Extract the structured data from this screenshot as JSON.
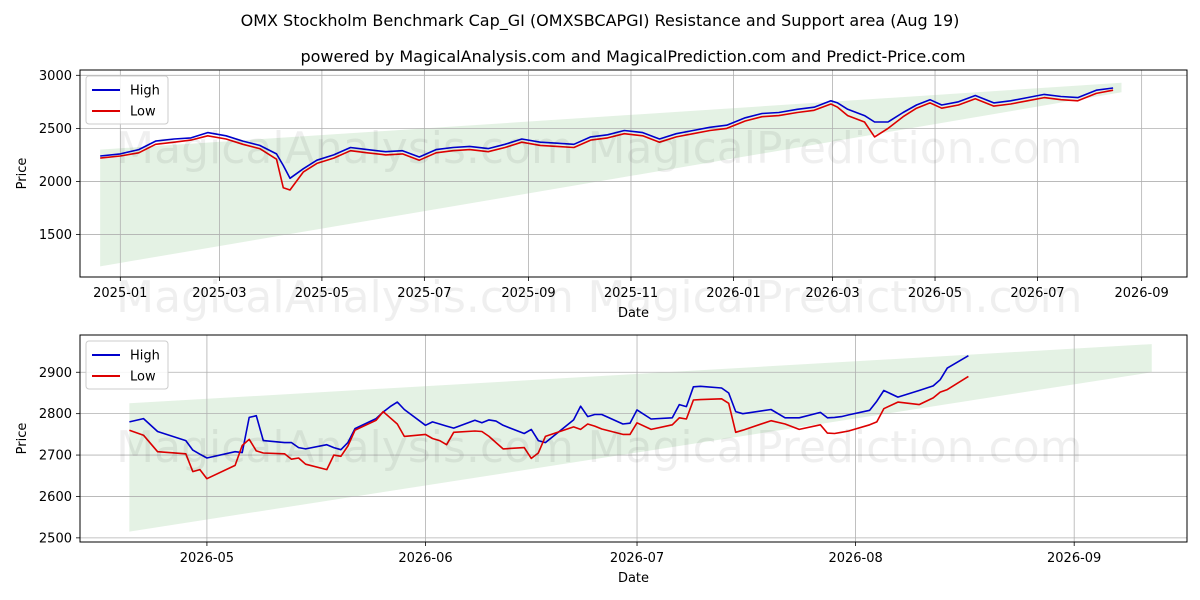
{
  "titles": {
    "main": "OMX Stockholm Benchmark Cap_GI (OMXSBCAPGI) Resistance and Support area (Aug 19)",
    "sub": "powered by MagicalAnalysis.com and MagicalPrediction.com and Predict-Price.com"
  },
  "watermarks": [
    "MagicalAnalysis.com",
    "MagicalPrediction.com"
  ],
  "colors": {
    "high": "#0000cc",
    "low": "#dd0000",
    "band": "#d6ebd6",
    "grid": "#b0b0b0"
  },
  "chart_data": [
    {
      "type": "line",
      "xlabel": "Date",
      "ylabel": "Price",
      "grid": true,
      "legend_placement": "top-left",
      "xlim": [
        "2024-12-08",
        "2026-09-28"
      ],
      "ylim": [
        1100,
        3050
      ],
      "x_ticks": [
        {
          "date": "2025-01-01",
          "label": "2025-01"
        },
        {
          "date": "2025-03-01",
          "label": "2025-03"
        },
        {
          "date": "2025-05-01",
          "label": "2025-05"
        },
        {
          "date": "2025-07-01",
          "label": "2025-07"
        },
        {
          "date": "2025-09-01",
          "label": "2025-09"
        },
        {
          "date": "2025-11-01",
          "label": "2025-11"
        },
        {
          "date": "2026-01-01",
          "label": "2026-01"
        },
        {
          "date": "2026-03-01",
          "label": "2026-03"
        },
        {
          "date": "2026-05-01",
          "label": "2026-05"
        },
        {
          "date": "2026-07-01",
          "label": "2026-07"
        },
        {
          "date": "2026-09-01",
          "label": "2026-09"
        }
      ],
      "y_ticks": [
        1500,
        2000,
        2500,
        3000
      ],
      "band": {
        "x": [
          "2024-12-20",
          "2026-08-20"
        ],
        "lower": [
          1200,
          2840
        ],
        "upper": [
          2300,
          2930
        ]
      },
      "series": [
        {
          "name": "High",
          "x": [
            "2024-12-20",
            "2025-01-01",
            "2025-01-12",
            "2025-01-22",
            "2025-02-02",
            "2025-02-12",
            "2025-02-22",
            "2025-03-05",
            "2025-03-15",
            "2025-03-25",
            "2025-04-04",
            "2025-04-08",
            "2025-04-12",
            "2025-04-20",
            "2025-04-28",
            "2025-05-08",
            "2025-05-18",
            "2025-05-28",
            "2025-06-08",
            "2025-06-18",
            "2025-06-28",
            "2025-07-08",
            "2025-07-18",
            "2025-07-28",
            "2025-08-08",
            "2025-08-18",
            "2025-08-28",
            "2025-09-08",
            "2025-09-18",
            "2025-09-28",
            "2025-10-08",
            "2025-10-18",
            "2025-10-28",
            "2025-11-08",
            "2025-11-18",
            "2025-11-28",
            "2025-12-08",
            "2025-12-18",
            "2025-12-28",
            "2026-01-08",
            "2026-01-18",
            "2026-01-28",
            "2026-02-08",
            "2026-02-18",
            "2026-02-28",
            "2026-03-04",
            "2026-03-10",
            "2026-03-20",
            "2026-03-26",
            "2026-04-03",
            "2026-04-12",
            "2026-04-20",
            "2026-04-28",
            "2026-05-05",
            "2026-05-15",
            "2026-05-25",
            "2026-06-05",
            "2026-06-15",
            "2026-06-25",
            "2026-07-05",
            "2026-07-15",
            "2026-07-25",
            "2026-08-05",
            "2026-08-15"
          ],
          "values": [
            2240,
            2260,
            2300,
            2380,
            2400,
            2410,
            2460,
            2430,
            2380,
            2340,
            2260,
            2150,
            2030,
            2120,
            2200,
            2250,
            2320,
            2300,
            2280,
            2290,
            2230,
            2300,
            2320,
            2330,
            2310,
            2350,
            2400,
            2370,
            2360,
            2350,
            2420,
            2440,
            2480,
            2460,
            2400,
            2450,
            2480,
            2510,
            2530,
            2600,
            2640,
            2650,
            2680,
            2700,
            2760,
            2740,
            2680,
            2620,
            2560,
            2560,
            2650,
            2720,
            2770,
            2720,
            2750,
            2810,
            2740,
            2760,
            2790,
            2820,
            2800,
            2790,
            2860,
            2880
          ]
        },
        {
          "name": "Low",
          "x": [
            "2024-12-20",
            "2025-01-01",
            "2025-01-12",
            "2025-01-22",
            "2025-02-02",
            "2025-02-12",
            "2025-02-22",
            "2025-03-05",
            "2025-03-15",
            "2025-03-25",
            "2025-04-04",
            "2025-04-08",
            "2025-04-12",
            "2025-04-20",
            "2025-04-28",
            "2025-05-08",
            "2025-05-18",
            "2025-05-28",
            "2025-06-08",
            "2025-06-18",
            "2025-06-28",
            "2025-07-08",
            "2025-07-18",
            "2025-07-28",
            "2025-08-08",
            "2025-08-18",
            "2025-08-28",
            "2025-09-08",
            "2025-09-18",
            "2025-09-28",
            "2025-10-08",
            "2025-10-18",
            "2025-10-28",
            "2025-11-08",
            "2025-11-18",
            "2025-11-28",
            "2025-12-08",
            "2025-12-18",
            "2025-12-28",
            "2026-01-08",
            "2026-01-18",
            "2026-01-28",
            "2026-02-08",
            "2026-02-18",
            "2026-02-28",
            "2026-03-04",
            "2026-03-10",
            "2026-03-20",
            "2026-03-26",
            "2026-04-03",
            "2026-04-12",
            "2026-04-20",
            "2026-04-28",
            "2026-05-05",
            "2026-05-15",
            "2026-05-25",
            "2026-06-05",
            "2026-06-15",
            "2026-06-25",
            "2026-07-05",
            "2026-07-15",
            "2026-07-25",
            "2026-08-05",
            "2026-08-15"
          ],
          "values": [
            2220,
            2240,
            2270,
            2350,
            2370,
            2390,
            2430,
            2400,
            2350,
            2310,
            2210,
            1940,
            1920,
            2090,
            2170,
            2220,
            2290,
            2270,
            2250,
            2260,
            2200,
            2270,
            2290,
            2300,
            2280,
            2320,
            2370,
            2340,
            2330,
            2320,
            2390,
            2410,
            2450,
            2430,
            2370,
            2420,
            2450,
            2480,
            2500,
            2570,
            2610,
            2620,
            2650,
            2670,
            2730,
            2700,
            2620,
            2560,
            2420,
            2500,
            2610,
            2690,
            2740,
            2690,
            2720,
            2780,
            2710,
            2730,
            2760,
            2790,
            2770,
            2760,
            2830,
            2860
          ]
        }
      ]
    },
    {
      "type": "line",
      "xlabel": "Date",
      "ylabel": "Price",
      "grid": true,
      "legend_placement": "top-left",
      "xlim": [
        "2026-04-13",
        "2026-09-17"
      ],
      "ylim": [
        2490,
        2990
      ],
      "x_ticks": [
        {
          "date": "2026-05-01",
          "label": "2026-05"
        },
        {
          "date": "2026-06-01",
          "label": "2026-06"
        },
        {
          "date": "2026-07-01",
          "label": "2026-07"
        },
        {
          "date": "2026-08-01",
          "label": "2026-08"
        },
        {
          "date": "2026-09-01",
          "label": "2026-09"
        }
      ],
      "y_ticks": [
        2500,
        2600,
        2700,
        2800,
        2900
      ],
      "band": {
        "x": [
          "2026-04-20",
          "2026-09-12"
        ],
        "lower": [
          2515,
          2900
        ],
        "upper": [
          2825,
          2968
        ]
      },
      "series": [
        {
          "name": "High",
          "x": [
            "2026-04-20",
            "2026-04-22",
            "2026-04-24",
            "2026-04-28",
            "2026-04-29",
            "2026-04-30",
            "2026-05-01",
            "2026-05-05",
            "2026-05-06",
            "2026-05-07",
            "2026-05-08",
            "2026-05-09",
            "2026-05-12",
            "2026-05-13",
            "2026-05-14",
            "2026-05-15",
            "2026-05-18",
            "2026-05-19",
            "2026-05-20",
            "2026-05-21",
            "2026-05-22",
            "2026-05-25",
            "2026-05-26",
            "2026-05-27",
            "2026-05-28",
            "2026-05-29",
            "2026-06-01",
            "2026-06-02",
            "2026-06-03",
            "2026-06-04",
            "2026-06-05",
            "2026-06-08",
            "2026-06-09",
            "2026-06-10",
            "2026-06-11",
            "2026-06-12",
            "2026-06-15",
            "2026-06-16",
            "2026-06-17",
            "2026-06-18",
            "2026-06-22",
            "2026-06-23",
            "2026-06-24",
            "2026-06-25",
            "2026-06-26",
            "2026-06-29",
            "2026-06-30",
            "2026-07-01",
            "2026-07-03",
            "2026-07-06",
            "2026-07-07",
            "2026-07-08",
            "2026-07-09",
            "2026-07-10",
            "2026-07-13",
            "2026-07-14",
            "2026-07-15",
            "2026-07-16",
            "2026-07-20",
            "2026-07-22",
            "2026-07-24",
            "2026-07-27",
            "2026-07-28",
            "2026-07-29",
            "2026-07-30",
            "2026-07-31",
            "2026-08-03",
            "2026-08-04",
            "2026-08-05",
            "2026-08-07",
            "2026-08-10",
            "2026-08-12",
            "2026-08-13",
            "2026-08-14",
            "2026-08-17"
          ],
          "values": [
            2780,
            2788,
            2757,
            2735,
            2712,
            2702,
            2693,
            2708,
            2706,
            2791,
            2795,
            2735,
            2730,
            2730,
            2718,
            2715,
            2725,
            2718,
            2713,
            2730,
            2764,
            2788,
            2804,
            2817,
            2828,
            2810,
            2772,
            2780,
            2775,
            2770,
            2765,
            2784,
            2778,
            2785,
            2782,
            2772,
            2752,
            2762,
            2735,
            2730,
            2785,
            2818,
            2793,
            2798,
            2798,
            2775,
            2777,
            2809,
            2787,
            2790,
            2822,
            2817,
            2865,
            2866,
            2862,
            2850,
            2805,
            2800,
            2810,
            2790,
            2790,
            2803,
            2790,
            2791,
            2793,
            2797,
            2808,
            2830,
            2856,
            2840,
            2856,
            2867,
            2882,
            2910,
            2940
          ]
        },
        {
          "name": "Low",
          "x": [
            "2026-04-20",
            "2026-04-22",
            "2026-04-24",
            "2026-04-28",
            "2026-04-29",
            "2026-04-30",
            "2026-05-01",
            "2026-05-05",
            "2026-05-06",
            "2026-05-07",
            "2026-05-08",
            "2026-05-09",
            "2026-05-12",
            "2026-05-13",
            "2026-05-14",
            "2026-05-15",
            "2026-05-18",
            "2026-05-19",
            "2026-05-20",
            "2026-05-21",
            "2026-05-22",
            "2026-05-25",
            "2026-05-26",
            "2026-05-27",
            "2026-05-28",
            "2026-05-29",
            "2026-06-01",
            "2026-06-02",
            "2026-06-03",
            "2026-06-04",
            "2026-06-05",
            "2026-06-08",
            "2026-06-09",
            "2026-06-10",
            "2026-06-11",
            "2026-06-12",
            "2026-06-15",
            "2026-06-16",
            "2026-06-17",
            "2026-06-18",
            "2026-06-22",
            "2026-06-23",
            "2026-06-24",
            "2026-06-25",
            "2026-06-26",
            "2026-06-29",
            "2026-06-30",
            "2026-07-01",
            "2026-07-03",
            "2026-07-06",
            "2026-07-07",
            "2026-07-08",
            "2026-07-09",
            "2026-07-10",
            "2026-07-13",
            "2026-07-14",
            "2026-07-15",
            "2026-07-16",
            "2026-07-20",
            "2026-07-22",
            "2026-07-24",
            "2026-07-27",
            "2026-07-28",
            "2026-07-29",
            "2026-07-30",
            "2026-07-31",
            "2026-08-03",
            "2026-08-04",
            "2026-08-05",
            "2026-08-07",
            "2026-08-10",
            "2026-08-12",
            "2026-08-13",
            "2026-08-14",
            "2026-08-17"
          ],
          "values": [
            2760,
            2748,
            2708,
            2703,
            2660,
            2665,
            2643,
            2675,
            2723,
            2738,
            2710,
            2705,
            2703,
            2690,
            2693,
            2678,
            2665,
            2700,
            2697,
            2722,
            2760,
            2784,
            2805,
            2790,
            2775,
            2745,
            2750,
            2740,
            2735,
            2725,
            2755,
            2758,
            2757,
            2745,
            2730,
            2715,
            2718,
            2692,
            2705,
            2745,
            2768,
            2762,
            2775,
            2770,
            2763,
            2750,
            2750,
            2778,
            2762,
            2773,
            2790,
            2787,
            2833,
            2834,
            2836,
            2825,
            2755,
            2760,
            2783,
            2775,
            2762,
            2773,
            2753,
            2752,
            2755,
            2758,
            2773,
            2780,
            2812,
            2828,
            2822,
            2838,
            2852,
            2858,
            2890
          ]
        }
      ]
    }
  ]
}
